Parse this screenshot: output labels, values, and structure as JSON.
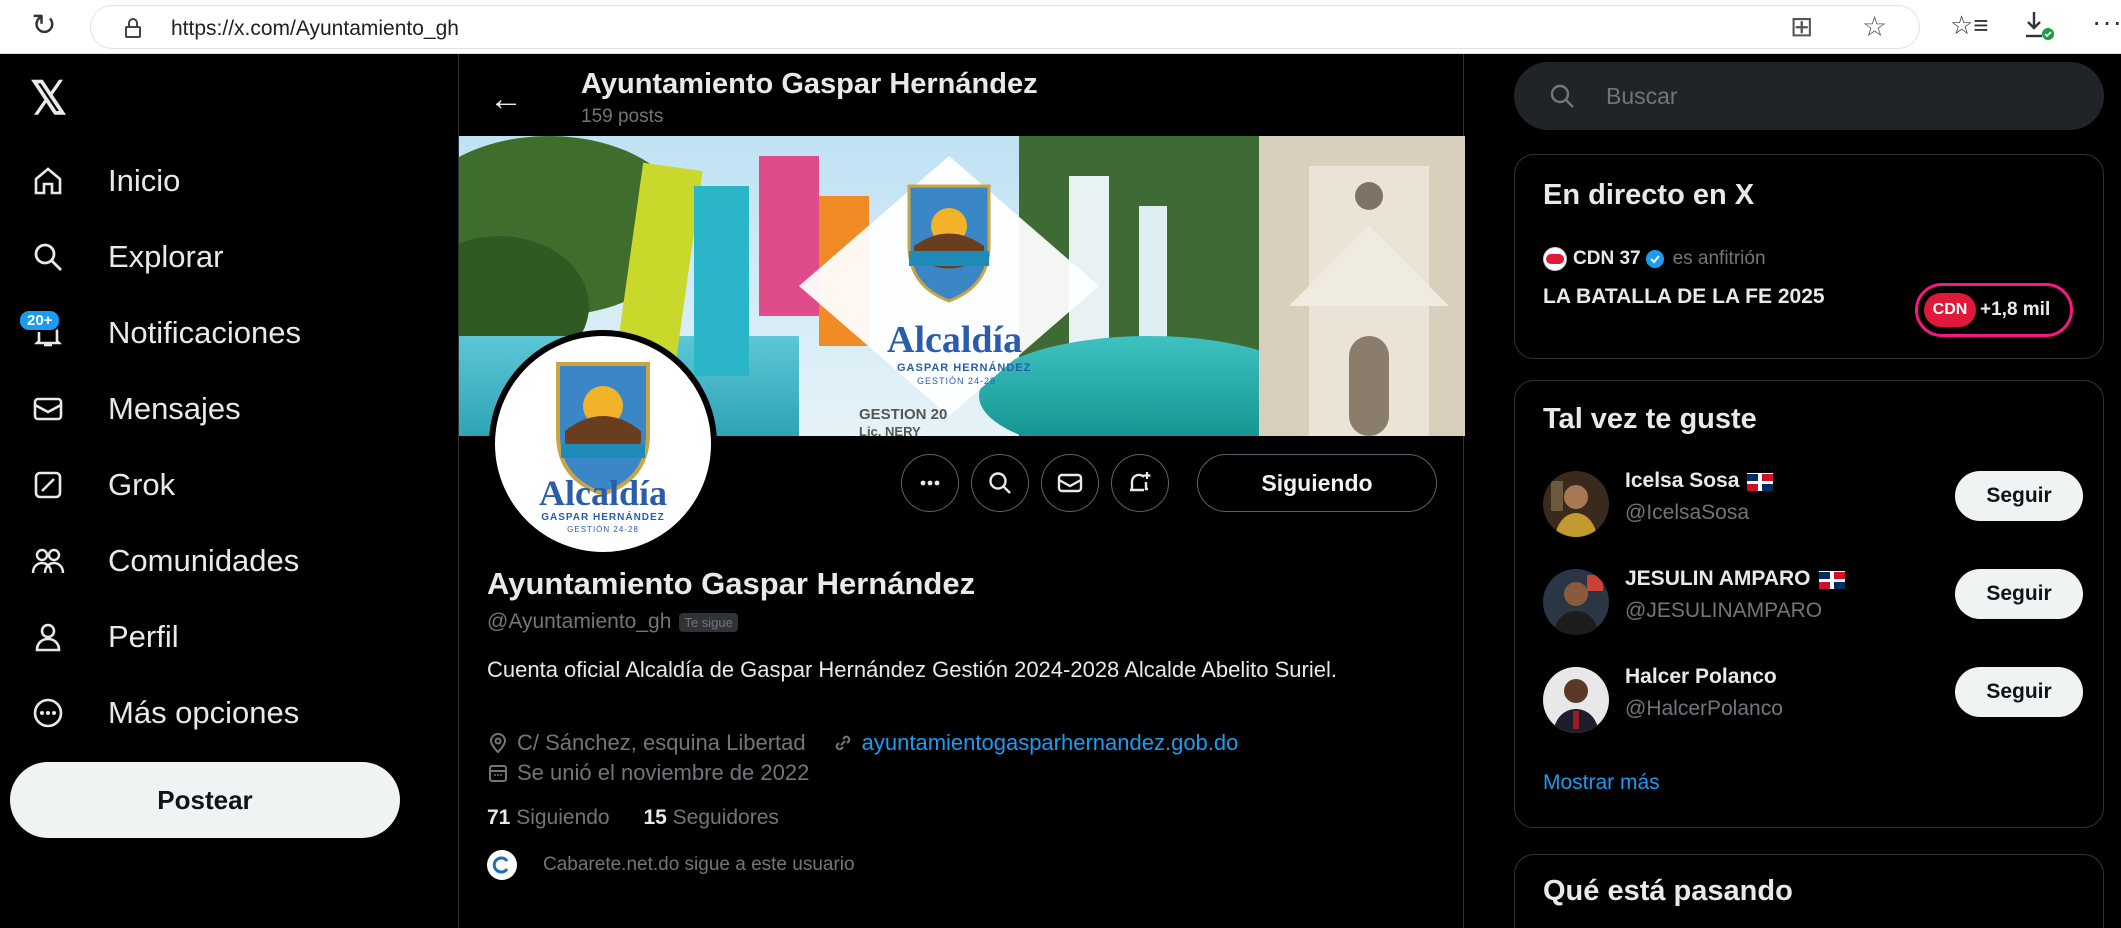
{
  "browser": {
    "url": "https://x.com/Ayuntamiento_gh"
  },
  "nav": {
    "badge": "20+",
    "items": [
      {
        "label": "Inicio"
      },
      {
        "label": "Explorar"
      },
      {
        "label": "Notificaciones"
      },
      {
        "label": "Mensajes"
      },
      {
        "label": "Grok"
      },
      {
        "label": "Comunidades"
      },
      {
        "label": "Perfil"
      },
      {
        "label": "Más opciones"
      }
    ],
    "post_label": "Postear"
  },
  "header": {
    "title": "Ayuntamiento Gaspar Hernández",
    "posts": "159 posts"
  },
  "banner": {
    "logo_text": "Alcaldía",
    "logo_sub": "GASPAR HERNÁNDEZ",
    "logo_sub2": "GESTIÓN 24-28",
    "sign_text": "GESTION 20",
    "sign_text2": "Lic. NERY"
  },
  "profile": {
    "avatar_text": "Alcaldía",
    "avatar_sub": "GASPAR HERNÁNDEZ",
    "avatar_sub2": "GESTIÓN 24-28",
    "follow_label": "Siguiendo",
    "name": "Ayuntamiento Gaspar Hernández",
    "handle": "@Ayuntamiento_gh",
    "follows_you": "Te sigue",
    "bio": "Cuenta oficial Alcaldía de Gaspar Hernández Gestión 2024-2028 Alcalde Abelito Suriel.",
    "location": "C/ Sánchez, esquina Libertad",
    "website": "ayuntamientogasparhernandez.gob.do",
    "joined": "Se unió el noviembre de 2022",
    "following_count": "71",
    "following_label": "Siguiendo",
    "followers_count": "15",
    "followers_label": "Seguidores",
    "followed_by": "Cabarete.net.do sigue a este usuario"
  },
  "search": {
    "placeholder": "Buscar"
  },
  "live": {
    "title": "En directo en X",
    "host_name": "CDN 37",
    "host_suffix": "es anfitrión",
    "event_title": "LA BATALLA DE LA FE 2025",
    "pill_logo": "CDN",
    "pill_count": "+1,8 mil"
  },
  "suggestions": {
    "title": "Tal vez te guste",
    "follow_label": "Seguir",
    "show_more": "Mostrar más",
    "items": [
      {
        "name": "Icelsa Sosa",
        "handle": "@IcelsaSosa"
      },
      {
        "name": "JESULIN AMPARO",
        "handle": "@JESULINAMPARO"
      },
      {
        "name": "Halcer Polanco",
        "handle": "@HalcerPolanco"
      }
    ]
  },
  "trends": {
    "title": "Qué está pasando"
  },
  "colors": {
    "accent": "#1d9bf0",
    "background": "#000000",
    "text": "#e7e9ea",
    "muted": "#71767b",
    "border": "#2f3336",
    "live_pink": "#f91880"
  }
}
